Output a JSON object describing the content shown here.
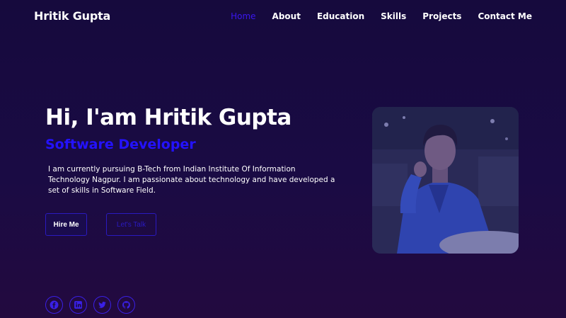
{
  "brand": "Hritik Gupta",
  "nav": {
    "items": [
      "Home",
      "About",
      "Education",
      "Skills",
      "Projects",
      "Contact Me"
    ],
    "active": "Home"
  },
  "hero": {
    "title": "Hi, I'am Hritik Gupta",
    "subtitle": "Software Developer",
    "description": "I am currently pursuing B-Tech from Indian Institute Of Information Technology Nagpur. I am passionate about technology and have developed a set of skills in Software Field.",
    "hire_button": "Hire Me",
    "talk_button": "Let's Talk"
  },
  "socials": [
    "facebook-icon",
    "linkedin-icon",
    "twitter-icon",
    "github-icon"
  ],
  "colors": {
    "background": "#1a0b44",
    "accent": "#2412ff",
    "text": "#ffffff"
  }
}
